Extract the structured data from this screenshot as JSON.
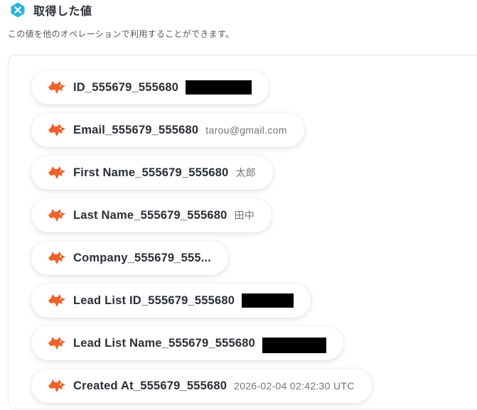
{
  "header": {
    "title": "取得した値",
    "subtitle": "この値を他のオペレーションで利用することができます。",
    "icon": "yoom-x-icon",
    "icon_color": "#2bb3d9"
  },
  "colors": {
    "fox_icon": "#f0602a"
  },
  "items": [
    {
      "label": "ID_555679_555680",
      "value": "",
      "redacted": true
    },
    {
      "label": "Email_555679_555680",
      "value": "tarou@gmail.com",
      "redacted": false
    },
    {
      "label": "First Name_555679_555680",
      "value": "太郎",
      "redacted": false
    },
    {
      "label": "Last Name_555679_555680",
      "value": "田中",
      "redacted": false
    },
    {
      "label": "Company_555679_555...",
      "value": "",
      "redacted": false
    },
    {
      "label": "Lead List ID_555679_555680",
      "value": "",
      "redacted": true
    },
    {
      "label": "Lead List Name_555679_555680",
      "value": "",
      "redacted": true
    },
    {
      "label": "Created At_555679_555680",
      "value": "2026-02-04 02:42:30 UTC",
      "redacted": false
    }
  ]
}
